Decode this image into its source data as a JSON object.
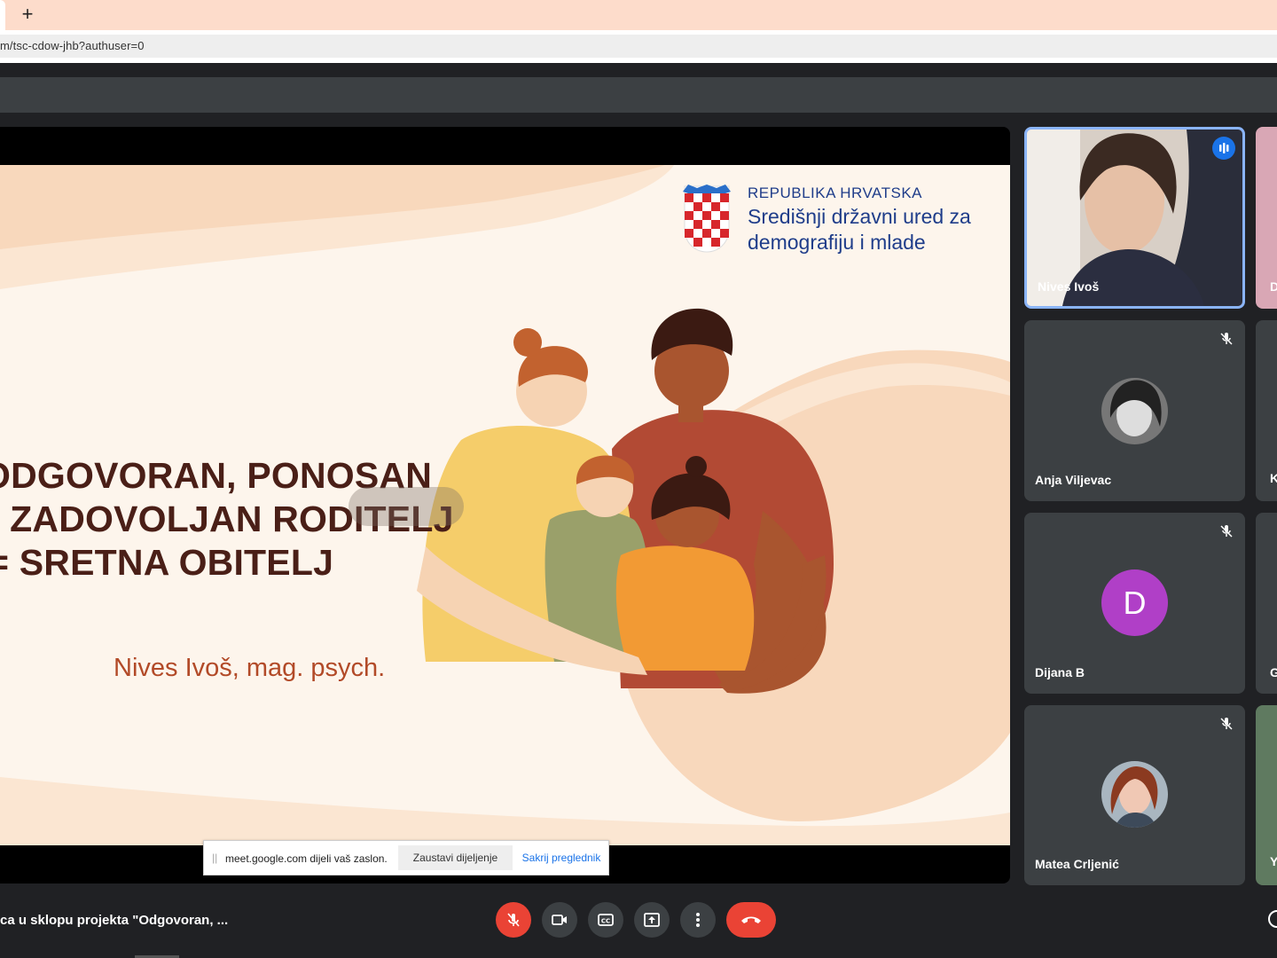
{
  "browser": {
    "new_tab_label": "+",
    "url": "m/tsc-cdow-jhb?authuser=0"
  },
  "slide": {
    "logo_line1": "REPUBLIKA HRVATSKA",
    "logo_line2": "Središnji državni ured za",
    "logo_line3": "demografiju i mlade",
    "title_line1": "ODGOVORAN, PONOSAN",
    "title_line2": "I ZADOVOLJAN RODITELJ",
    "title_line3": "= SRETNA OBITELJ",
    "author": "Nives Ivoš, mag. psych."
  },
  "share_bar": {
    "message": "meet.google.com dijeli vaš zaslon.",
    "stop_label": "Zaustavi dijeljenje",
    "hide_label": "Sakrij preglednik"
  },
  "participants": [
    {
      "name": "Nives Ivoš",
      "state": "speaking",
      "video": true
    },
    {
      "name": "Anja Viljevac",
      "state": "muted",
      "avatar": "photo"
    },
    {
      "name": "Dijana B",
      "state": "muted",
      "avatar_letter": "D",
      "avatar_color": "#b03fc7"
    },
    {
      "name": "Matea Crljenić",
      "state": "muted",
      "avatar": "photo"
    }
  ],
  "edge_participants": [
    "D",
    "K",
    "G",
    "Y"
  ],
  "meeting": {
    "title": "ca u sklopu projekta \"Odgovoran, ..."
  },
  "controls": [
    "mic-off-icon",
    "camera-icon",
    "captions-icon",
    "present-icon",
    "more-icon",
    "hangup-icon"
  ],
  "colors": {
    "accent": "#1a73e8",
    "danger": "#ea4335",
    "tile_bg": "#3c4043",
    "slide_text": "#4a1f17"
  }
}
